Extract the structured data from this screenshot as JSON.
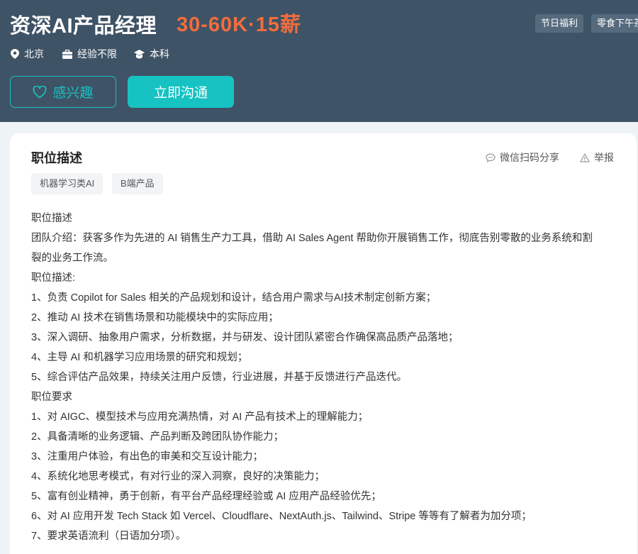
{
  "job": {
    "title": "资深AI产品经理",
    "salary": "30-60K·15薪",
    "welfare": [
      "节日福利",
      "零食下午茶"
    ],
    "meta": {
      "city": "北京",
      "experience": "经验不限",
      "degree": "本科"
    }
  },
  "actions": {
    "interest_label": "感兴趣",
    "chat_label": "立即沟通"
  },
  "section": {
    "title": "职位描述",
    "share_label": "微信扫码分享",
    "report_label": "举报",
    "tags": [
      "机器学习类AI",
      "B端产品"
    ]
  },
  "description": {
    "lines": [
      "职位描述",
      "团队介绍：获客多作为先进的 AI 销售生产力工具，借助 AI Sales Agent 帮助你开展销售工作，彻底告别零散的业务系统和割",
      "裂的业务工作流。",
      "职位描述:",
      "1、负责 Copilot for Sales 相关的产品规划和设计，结合用户需求与AI技术制定创新方案；",
      "2、推动 AI 技术在销售场景和功能模块中的实际应用；",
      "3、深入调研、抽象用户需求，分析数据，并与研发、设计团队紧密合作确保高品质产品落地；",
      "4、主导 AI 和机器学习应用场景的研究和规划；",
      "5、综合评估产品效果，持续关注用户反馈，行业进展，并基于反馈进行产品迭代。",
      "职位要求",
      "1、对 AIGC、模型技术与应用充满热情，对 AI 产品有技术上的理解能力；",
      "2、具备清晰的业务逻辑、产品判断及跨团队协作能力；",
      "3、注重用户体验，有出色的审美和交互设计能力；",
      "4、系统化地思考模式，有对行业的深入洞察，良好的决策能力；",
      "5、富有创业精神，勇于创新，有平台产品经理经验或 AI 应用产品经验优先；",
      "6、对 AI 应用开发 Tech Stack 如 Vercel、Cloudflare、NextAuth.js、Tailwind、Stripe 等等有了解者为加分项；",
      "7、要求英语流利（日语加分项）。"
    ]
  },
  "colors": {
    "header_bg": "#3f5366",
    "salary": "#f26d3d",
    "accent": "#16c2c2",
    "page_bg": "#eef3f6"
  },
  "icons": {
    "city": "location-pin-icon",
    "experience": "briefcase-icon",
    "degree": "graduation-cap-icon",
    "interest": "heart-icon",
    "share": "chat-bubble-icon",
    "report": "warning-triangle-icon"
  }
}
